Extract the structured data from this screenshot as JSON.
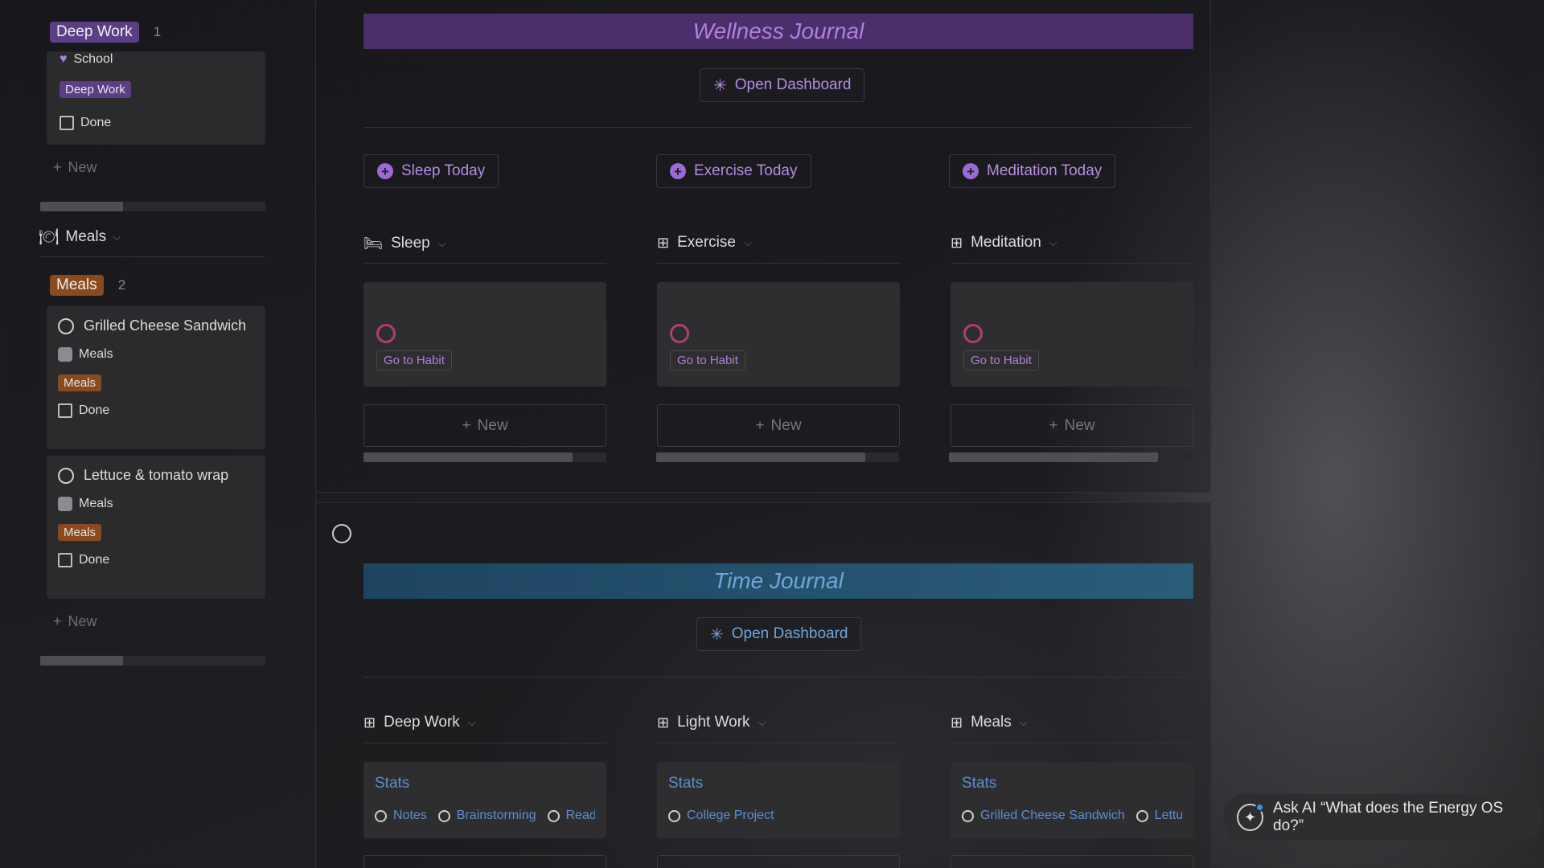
{
  "sidebar": {
    "deep_work_group": {
      "label": "Deep Work",
      "count": "1",
      "card": {
        "relation": "School",
        "tag": "Deep Work",
        "checkbox_label": "Done"
      },
      "new_label": "New"
    },
    "meals_section": {
      "title": "Meals",
      "group_label": "Meals",
      "count": "2",
      "items": [
        {
          "title": "Grilled Cheese Sandwich",
          "relation": "Meals",
          "tag": "Meals",
          "checkbox_label": "Done"
        },
        {
          "title": "Lettuce & tomato wrap",
          "relation": "Meals",
          "tag": "Meals",
          "checkbox_label": "Done"
        }
      ],
      "new_label": "New"
    }
  },
  "wellness": {
    "title": "Wellness Journal",
    "open_dashboard": "Open Dashboard",
    "add_buttons": [
      "Sleep Today",
      "Exercise Today",
      "Meditation Today"
    ],
    "views": [
      {
        "name": "Sleep",
        "goto_label": "Go to Habit",
        "new_label": "New"
      },
      {
        "name": "Exercise",
        "goto_label": "Go to Habit",
        "new_label": "New"
      },
      {
        "name": "Meditation",
        "goto_label": "Go to Habit",
        "new_label": "New"
      }
    ]
  },
  "time": {
    "title": "Time Journal",
    "open_dashboard": "Open Dashboard",
    "views": [
      {
        "name": "Deep Work",
        "stats_title": "Stats",
        "items": [
          "Notes",
          "Brainstorming",
          "Readir"
        ]
      },
      {
        "name": "Light Work",
        "stats_title": "Stats",
        "items": [
          "College Project"
        ]
      },
      {
        "name": "Meals",
        "stats_title": "Stats",
        "items": [
          "Grilled Cheese Sandwich",
          "Lettuce"
        ]
      }
    ]
  },
  "ask_ai": {
    "label": "Ask AI “What does the Energy OS do?”"
  },
  "colors": {
    "wellness_banner": "#4a2f6a",
    "wellness_text": "#b07fe2",
    "time_banner": "#1f4a66",
    "time_text": "#6fa5da",
    "purple_tag": "#5b3f86",
    "orange_tag": "#8a4a1f",
    "habit_ring": "#b03f6e"
  },
  "icons": {
    "relation_school": "heart-icon",
    "relation_meals": "meal-icon",
    "meals_section": "fork-knife-icon",
    "sleep_view": "bed-icon",
    "gallery_view": "grid-icon",
    "dashboard": "sparkle-icon",
    "add": "plus-circle-icon",
    "ask_ai": "ai-sparkle-icon"
  }
}
